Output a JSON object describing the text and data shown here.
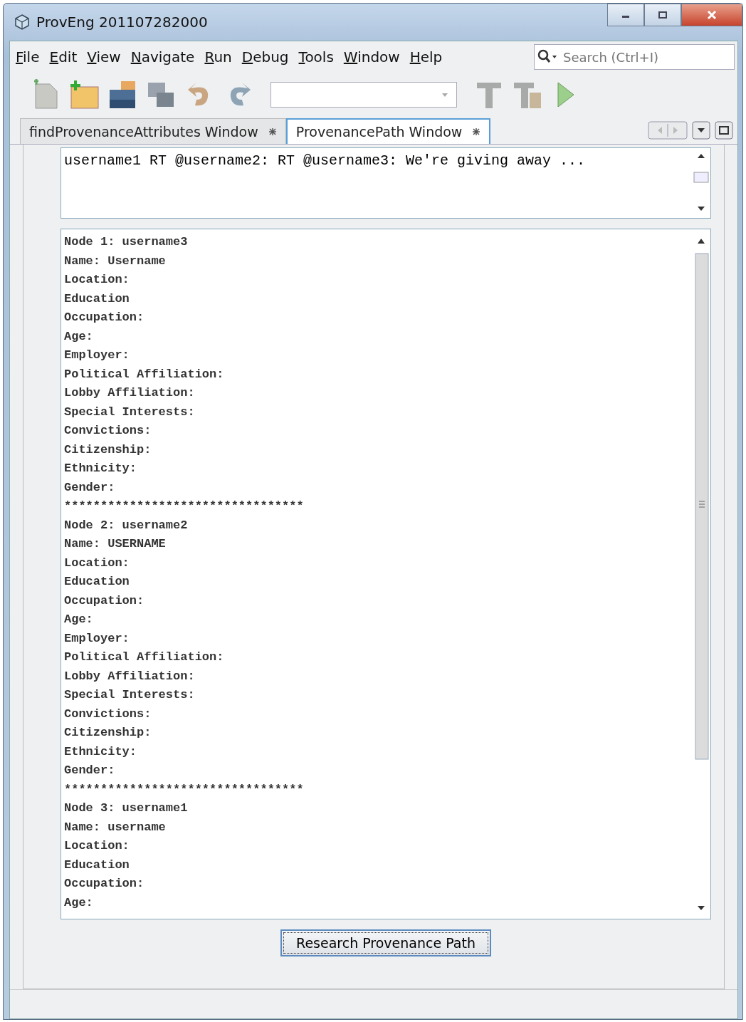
{
  "window": {
    "title": "ProvEng 201107282000"
  },
  "menu": [
    "File",
    "Edit",
    "View",
    "Navigate",
    "Run",
    "Debug",
    "Tools",
    "Window",
    "Help"
  ],
  "search": {
    "placeholder": "Search (Ctrl+I)"
  },
  "tabs": [
    {
      "label": "findProvenanceAttributes Window",
      "selected": false
    },
    {
      "label": "ProvenancePath Window",
      "selected": true
    }
  ],
  "query": {
    "value": "username1 RT @username2: RT @username3: We're giving away ..."
  },
  "output_lines": [
    "Node 1: username3",
    "Name: Username",
    "Location:",
    "Education",
    "Occupation:",
    "Age:",
    "Employer:",
    "Political Affiliation:",
    "Lobby Affiliation:",
    "Special Interests:",
    "Convictions:",
    "Citizenship:",
    "Ethnicity:",
    "Gender:",
    "*********************************",
    "Node 2: username2",
    "Name: USERNAME",
    "Location:",
    "Education",
    "Occupation:",
    "Age:",
    "Employer:",
    "Political Affiliation:",
    "Lobby Affiliation:",
    "Special Interests:",
    "Convictions:",
    "Citizenship:",
    "Ethnicity:",
    "Gender:",
    "*********************************",
    "Node 3: username1",
    "Name: username",
    "Location:",
    "Education",
    "Occupation:",
    "Age:"
  ],
  "button": "Research Provenance Path"
}
